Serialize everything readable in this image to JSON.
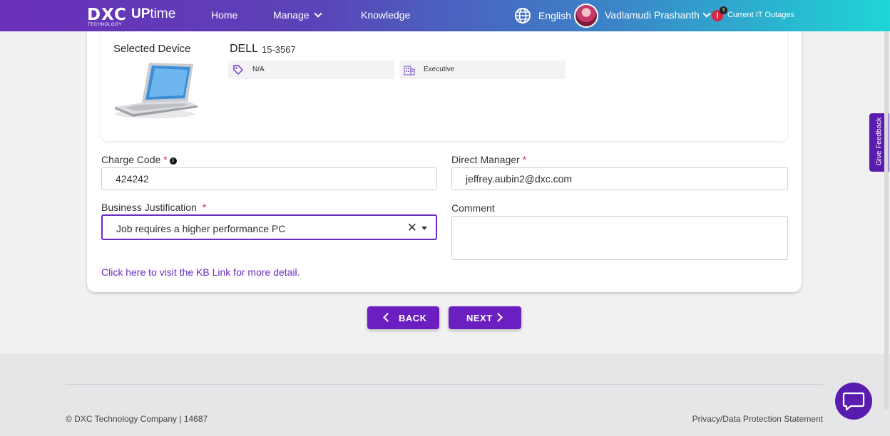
{
  "header": {
    "logo_text": "DXC",
    "logo_subtext": "TECHNOLOGY",
    "app_name_prefix": "UP",
    "app_name_suffix": "time",
    "nav": [
      "Home",
      "Manage",
      "Knowledge"
    ],
    "language": "English",
    "user_name": "Vadlamudi Prashanth",
    "alert_symbol": "!",
    "alert_count": "3",
    "outages_label": "Current IT Outages"
  },
  "device": {
    "section_label": "Selected Device",
    "brand": "DELL",
    "model": "15-3567",
    "tag_value": "N/A",
    "category_value": "Executive"
  },
  "form": {
    "charge_code_label": "Charge Code",
    "charge_code_value": "424242",
    "direct_manager_label": "Direct Manager",
    "direct_manager_value": "jeffrey.aubin2@dxc.com",
    "justification_label": "Business Justification",
    "justification_value": "Job requires a higher performance PC",
    "comment_label": "Comment",
    "comment_value": "",
    "kb_link": "Click here to visit the KB Link for more detail.",
    "required_mark": "*",
    "info_mark": "i",
    "clear_mark": "✕"
  },
  "actions": {
    "back": "BACK",
    "next": "NEXT"
  },
  "footer": {
    "copyright": "© DXC Technology Company | 14687",
    "privacy": "Privacy/Data Protection Statement"
  },
  "feedback_tab": "Give Feedback",
  "colors": {
    "accent": "#6c1fc0",
    "link": "#6c2bc1",
    "required": "#d7263d",
    "header_start": "#6b2fb8",
    "header_end": "#1ed6d6"
  },
  "icons": [
    "globe-icon",
    "chevron-down-icon",
    "tag-icon",
    "building-icon",
    "chevron-left-icon",
    "chevron-right-icon",
    "chat-icon",
    "info-icon",
    "close-icon",
    "caret-down-icon"
  ]
}
